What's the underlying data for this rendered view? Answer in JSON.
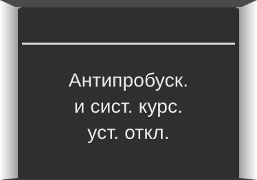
{
  "display": {
    "message_lines": [
      "Антипробуск.",
      "и сист. курс.",
      "уст. откл."
    ]
  },
  "colors": {
    "screen_background": "#2f2f2f",
    "text": "#ebebeb",
    "divider": "#d9d9d9",
    "bezel_edge": "#cfcfcf"
  }
}
